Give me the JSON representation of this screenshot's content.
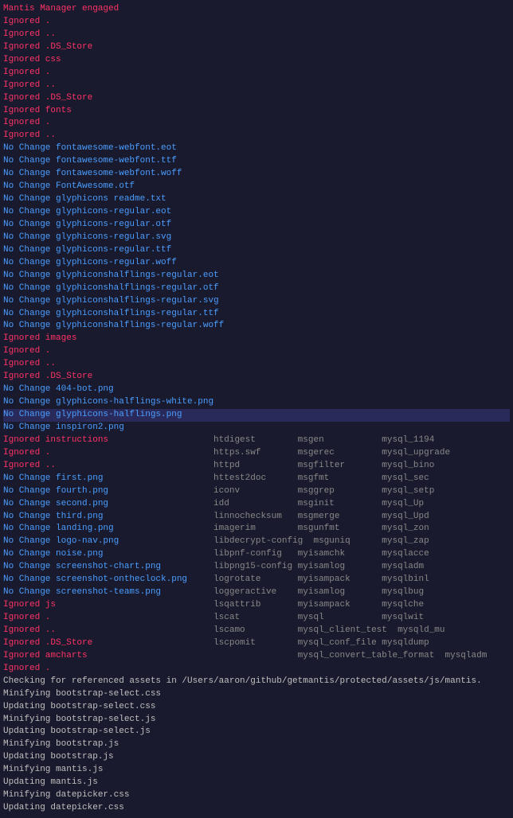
{
  "terminal": {
    "title": "Mantis Manager engaged",
    "lines": [
      {
        "type": "mantis-title",
        "text": "Mantis Manager engaged"
      },
      {
        "type": "ignored",
        "text": "Ignored ."
      },
      {
        "type": "ignored",
        "text": "Ignored .."
      },
      {
        "type": "ignored",
        "text": "Ignored .DS_Store"
      },
      {
        "type": "ignored",
        "text": "Ignored css"
      },
      {
        "type": "ignored",
        "text": "Ignored ."
      },
      {
        "type": "ignored",
        "text": "Ignored .."
      },
      {
        "type": "ignored",
        "text": "Ignored .DS_Store"
      },
      {
        "type": "ignored",
        "text": "Ignored fonts"
      },
      {
        "type": "ignored",
        "text": "Ignored ."
      },
      {
        "type": "ignored",
        "text": "Ignored .."
      },
      {
        "type": "no-change",
        "text": "No Change fontawesome-webfont.eot"
      },
      {
        "type": "no-change",
        "text": "No Change fontawesome-webfont.ttf"
      },
      {
        "type": "no-change",
        "text": "No Change fontawesome-webfont.woff"
      },
      {
        "type": "no-change",
        "text": "No Change FontAwesome.otf"
      },
      {
        "type": "no-change",
        "text": "No Change glyphicons readme.txt"
      },
      {
        "type": "no-change",
        "text": "No Change glyphicons-regular.eot"
      },
      {
        "type": "no-change",
        "text": "No Change glyphicons-regular.otf"
      },
      {
        "type": "no-change",
        "text": "No Change glyphicons-regular.svg"
      },
      {
        "type": "no-change",
        "text": "No Change glyphicons-regular.ttf"
      },
      {
        "type": "no-change",
        "text": "No Change glyphicons-regular.woff"
      },
      {
        "type": "no-change",
        "text": "No Change glyphiconshalflings-regular.eot"
      },
      {
        "type": "no-change",
        "text": "No Change glyphiconshalflings-regular.otf"
      },
      {
        "type": "no-change",
        "text": "No Change glyphiconshalflings-regular.svg"
      },
      {
        "type": "no-change",
        "text": "No Change glyphiconshalflings-regular.ttf"
      },
      {
        "type": "no-change",
        "text": "No Change glyphiconshalflings-regular.woff"
      },
      {
        "type": "ignored",
        "text": "Ignored images"
      },
      {
        "type": "ignored",
        "text": "Ignored ."
      },
      {
        "type": "ignored",
        "text": "Ignored .."
      },
      {
        "type": "ignored",
        "text": "Ignored .DS_Store"
      },
      {
        "type": "no-change",
        "text": "No Change 404-bot.png"
      },
      {
        "type": "no-change",
        "text": "No Change glyphicons-halflings-white.png"
      },
      {
        "type": "no-change",
        "highlighted": true,
        "text": "No Change glyphicons-halflings.png"
      },
      {
        "type": "no-change",
        "text": "No Change inspiron2.png"
      },
      {
        "type": "ignored",
        "text": "Ignored instructions"
      },
      {
        "type": "ignored",
        "text": "Ignored ."
      },
      {
        "type": "ignored",
        "text": "Ignored .."
      },
      {
        "type": "no-change",
        "text": "No Change first.png"
      },
      {
        "type": "no-change",
        "text": "No Change fourth.png"
      },
      {
        "type": "no-change",
        "text": "No Change second.png"
      },
      {
        "type": "no-change",
        "text": "No Change third.png"
      },
      {
        "type": "no-change",
        "text": "No Change landing.png"
      },
      {
        "type": "no-change",
        "text": "No Change logo-nav.png"
      },
      {
        "type": "no-change",
        "text": "No Change noise.png"
      },
      {
        "type": "no-change",
        "text": "No Change screenshot-chart.png"
      },
      {
        "type": "no-change",
        "text": "No Change screenshot-ontheclock.png"
      },
      {
        "type": "no-change",
        "text": "No Change screenshot-teams.png"
      },
      {
        "type": "ignored",
        "text": "Ignored js"
      },
      {
        "type": "ignored",
        "text": "Ignored ."
      },
      {
        "type": "ignored",
        "text": "Ignored .."
      },
      {
        "type": "ignored",
        "text": "Ignored .DS_Store"
      },
      {
        "type": "ignored",
        "text": "Ignored amcharts"
      },
      {
        "type": "ignored",
        "text": "Ignored ."
      },
      {
        "type": "checking",
        "text": "Checking for referenced assets in /Users/aaron/github/getmantis/protected/assets/js/mantis."
      },
      {
        "type": "minifying",
        "text": "Minifying bootstrap-select.css"
      },
      {
        "type": "minifying",
        "text": "Updating bootstrap-select.css"
      },
      {
        "type": "minifying",
        "text": "Minifying bootstrap-select.js"
      },
      {
        "type": "minifying",
        "text": "Updating bootstrap-select.js"
      },
      {
        "type": "minifying",
        "text": "Minifying bootstrap.js"
      },
      {
        "type": "minifying",
        "text": "Updating bootstrap.js"
      },
      {
        "type": "minifying",
        "text": "Minifying mantis.js"
      },
      {
        "type": "minifying",
        "text": "Updating mantis.js"
      },
      {
        "type": "minifying",
        "text": "Minifying datepicker.css"
      },
      {
        "type": "minifying",
        "text": "Updating datepicker.css"
      }
    ],
    "rightcolumn": [
      {
        "row": 33,
        "cols": [
          "htdigest",
          "msgen",
          "mysql_1194"
        ]
      },
      {
        "row": 34,
        "cols": [
          "https.swf",
          "msgerec",
          "mysql_upgrade"
        ]
      },
      {
        "row": 35,
        "cols": [
          "httpd",
          "msgfilter",
          "mysql_bino"
        ]
      },
      {
        "row": 36,
        "cols": [
          "httest2doc",
          "msgfmt",
          "mysql_sec"
        ]
      },
      {
        "row": 37,
        "cols": [
          "iconv",
          "msggrep",
          "mysql_setp"
        ]
      },
      {
        "row": 38,
        "cols": [
          "idd",
          "msginit",
          "mysql_Up"
        ]
      },
      {
        "row": 39,
        "cols": [
          "linnochecksum",
          "msgmerge",
          "mysql_Upd"
        ]
      },
      {
        "row": 40,
        "cols": [
          "imagerim",
          "msgunfmt",
          "mysql_zon"
        ]
      },
      {
        "row": 41,
        "cols": [
          "libdecrypt-config",
          "msguniq",
          "mysql_zap"
        ]
      },
      {
        "row": 42,
        "cols": [
          "libpnf-config",
          "myisamchk",
          "mysqlacce"
        ]
      },
      {
        "row": 43,
        "cols": [
          "libpng15-config",
          "myisamlog",
          "mysqladm"
        ]
      },
      {
        "row": 44,
        "cols": [
          "logrotate",
          "myisampack",
          "mysqlbinl"
        ]
      },
      {
        "row": 45,
        "cols": [
          "loggeractive",
          "myisamlog",
          "mysqlbug"
        ]
      },
      {
        "row": 46,
        "cols": [
          "lsqattrib",
          "myisampack",
          "mysqlche"
        ]
      },
      {
        "row": 47,
        "cols": [
          "lscat",
          "mysql",
          "mysqlwit"
        ]
      },
      {
        "row": 48,
        "cols": [
          "lscamo",
          "mysql_client_test",
          "mysqld_mu"
        ]
      },
      {
        "row": 49,
        "cols": [
          "lscpomit",
          "mysql_conf_file",
          "mysqldump"
        ]
      },
      {
        "row": 50,
        "cols": [
          "",
          "mysql_convert_table_format",
          "mysqladm"
        ]
      }
    ]
  }
}
